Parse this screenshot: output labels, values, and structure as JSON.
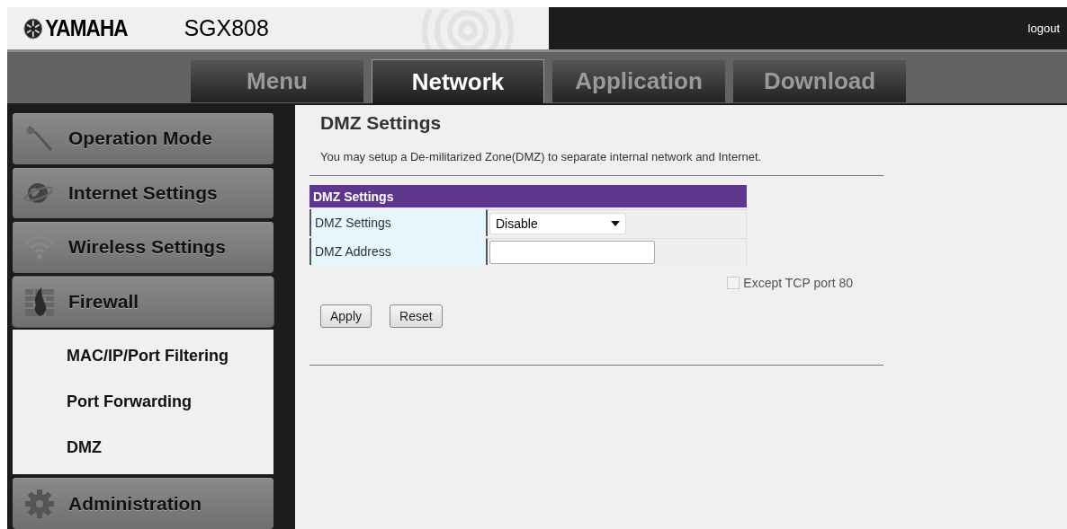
{
  "header": {
    "brand": "YAMAHA",
    "model": "SGX808",
    "logout": "logout"
  },
  "tabs": [
    {
      "label": "Menu",
      "selected": false
    },
    {
      "label": "Network",
      "selected": true
    },
    {
      "label": "Application",
      "selected": false
    },
    {
      "label": "Download",
      "selected": false
    }
  ],
  "sidebar": {
    "items": [
      {
        "label": "Operation Mode",
        "kind": "wrench",
        "expanded": false
      },
      {
        "label": "Internet Settings",
        "kind": "globe",
        "expanded": false
      },
      {
        "label": "Wireless Settings",
        "kind": "wifi",
        "expanded": false
      },
      {
        "label": "Firewall",
        "kind": "firewall",
        "expanded": true,
        "children": [
          {
            "label": "MAC/IP/Port Filtering"
          },
          {
            "label": "Port Forwarding"
          },
          {
            "label": "DMZ"
          }
        ]
      },
      {
        "label": "Administration",
        "kind": "gear",
        "expanded": false
      }
    ]
  },
  "content": {
    "title": "DMZ Settings",
    "description": "You may setup a De-militarized Zone(DMZ) to separate internal network and Internet.",
    "table": {
      "heading": "DMZ Settings",
      "rows": [
        {
          "label": "DMZ Settings",
          "kind": "select",
          "value": "Disable"
        },
        {
          "label": "DMZ Address",
          "kind": "text"
        }
      ]
    },
    "option": {
      "label": "Except TCP port 80",
      "checked": false,
      "disabled": true
    },
    "buttons": [
      "Apply",
      "Reset"
    ]
  }
}
